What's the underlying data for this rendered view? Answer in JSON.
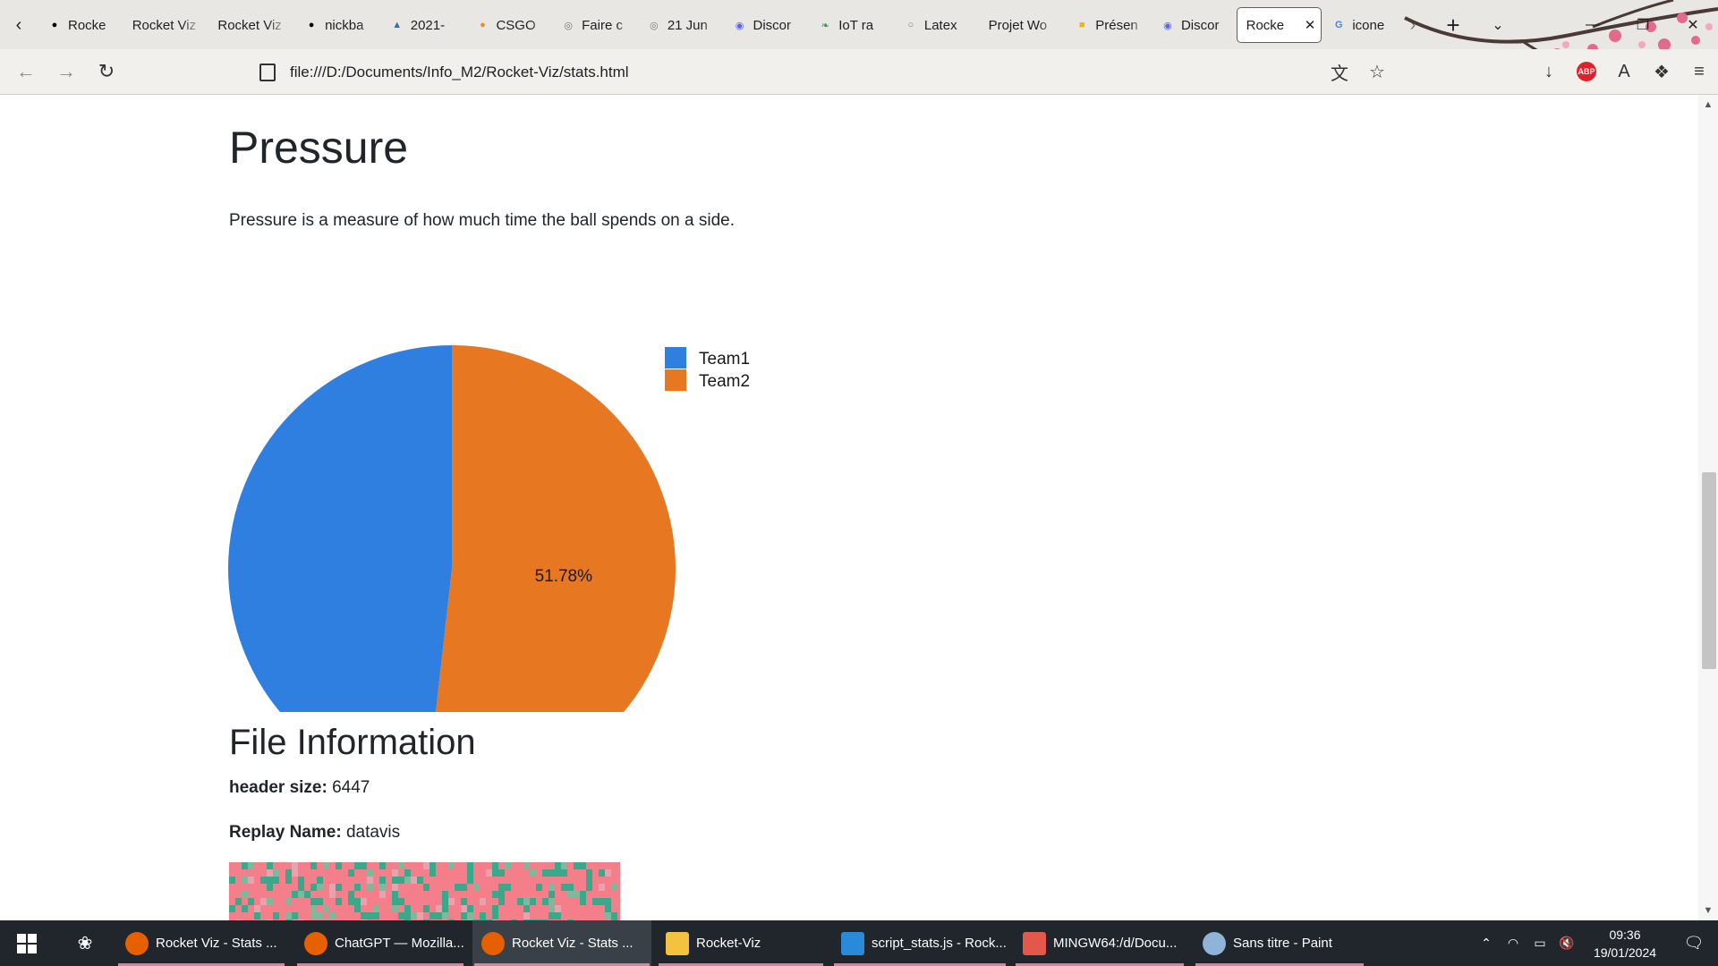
{
  "browser": {
    "tabs": [
      {
        "title": "Rocke",
        "icon": "github-icon",
        "color": "#000000"
      },
      {
        "title": "Rocket Viz",
        "icon": "none",
        "color": "#000000"
      },
      {
        "title": "Rocket Viz",
        "icon": "none",
        "color": "#000000"
      },
      {
        "title": "nickba",
        "icon": "github-icon",
        "color": "#000000"
      },
      {
        "title": "2021-",
        "icon": "car-icon",
        "color": "#3b6aa8"
      },
      {
        "title": "CSGO",
        "icon": "csgo-icon",
        "color": "#f08a24"
      },
      {
        "title": "Faire c",
        "icon": "circle-icon",
        "color": "#777777"
      },
      {
        "title": "21 Jun",
        "icon": "circle-icon",
        "color": "#777777"
      },
      {
        "title": "Discor",
        "icon": "discord-icon",
        "color": "#5865f2"
      },
      {
        "title": "IoT ra",
        "icon": "leaf-icon",
        "color": "#2e9e3e"
      },
      {
        "title": "Latex",
        "icon": "ring-icon",
        "color": "#4a7fd4"
      },
      {
        "title": "Projet Wo",
        "icon": "none",
        "color": "#000000"
      },
      {
        "title": "Présen",
        "icon": "slides-icon",
        "color": "#f4b400"
      },
      {
        "title": "Discor",
        "icon": "discord-icon",
        "color": "#5865f2"
      },
      {
        "title": "Rocke",
        "icon": "none",
        "color": "#000000",
        "active": true
      },
      {
        "title": "icone",
        "icon": "google-icon",
        "color": "#4285f4"
      }
    ],
    "url": "file:///D:/Documents/Info_M2/Rocket-Viz/stats.html"
  },
  "page": {
    "pressure_title": "Pressure",
    "pressure_description": "Pressure is a measure of how much time the ball spends on a side.",
    "file_info_title": "File Information",
    "header_size_label": "header size:",
    "header_size_value": "6447",
    "replay_name_label": "Replay Name:",
    "replay_name_value": "datavis"
  },
  "chart_data": {
    "type": "pie",
    "title": "",
    "labels": [
      "Team1",
      "Team2"
    ],
    "values": [
      48.22,
      51.78
    ],
    "colors": [
      "#2f7fe0",
      "#e87722"
    ],
    "slice_labels": [
      "",
      "51.78%"
    ],
    "legend_position": "right"
  },
  "taskbar": {
    "items": [
      {
        "label": "Rocket Viz - Stats ...",
        "icon": "firefox-icon",
        "active": false
      },
      {
        "label": "ChatGPT — Mozilla...",
        "icon": "firefox-icon",
        "active": false
      },
      {
        "label": "Rocket Viz - Stats ...",
        "icon": "firefox-icon",
        "active": true
      },
      {
        "label": "Rocket-Viz",
        "icon": "folder-icon",
        "active": false
      },
      {
        "label": "script_stats.js - Rock...",
        "icon": "vscode-icon",
        "active": false
      },
      {
        "label": "MINGW64:/d/Docu...",
        "icon": "git-icon",
        "active": false
      },
      {
        "label": "Sans titre - Paint",
        "icon": "paint-icon",
        "active": false
      }
    ],
    "time": "09:36",
    "date": "19/01/2024"
  }
}
